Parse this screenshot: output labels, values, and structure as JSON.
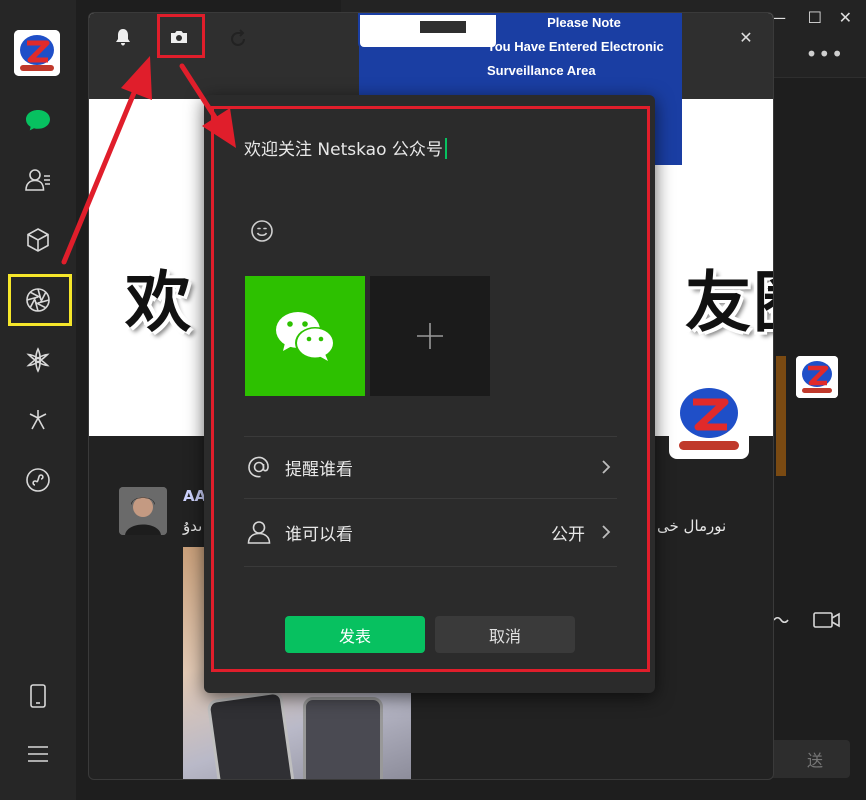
{
  "app": {
    "name": "WeChat"
  },
  "window_controls": {
    "minimize": "—",
    "maximize": "☐",
    "close": "✕"
  },
  "header": {
    "more": "•••"
  },
  "moments": {
    "close": "✕",
    "sign_line1": "Please Note",
    "sign_line2": "You Have Entered Electronic Surveillance Area",
    "cover_left": "欢",
    "cover_right": "友圈"
  },
  "feed": {
    "name": "AA",
    "text_left": "ىدۇ",
    "text_right": "نورمال خى"
  },
  "dialog": {
    "input_text": "欢迎关注 Netskao 公众号",
    "mention_label": "提醒谁看",
    "visibility_label": "谁可以看",
    "visibility_value": "公开",
    "publish_label": "发表",
    "cancel_label": "取消"
  },
  "chat": {
    "send_label": "送"
  },
  "colors": {
    "accent": "#07c160",
    "wechat_green": "#2dc100",
    "annotation_red": "#e01e2b",
    "annotation_yellow": "#f5e62a",
    "sign_blue": "#1a3ea3"
  },
  "icons": {
    "sidebar": [
      "chat-icon",
      "contacts-icon",
      "favorites-icon",
      "moments-icon",
      "channels-icon",
      "search-icon",
      "mini-programs-icon",
      "phone-icon",
      "menu-icon"
    ],
    "moments_toolbar": [
      "bell-icon",
      "camera-icon",
      "refresh-icon",
      "close-icon"
    ]
  }
}
